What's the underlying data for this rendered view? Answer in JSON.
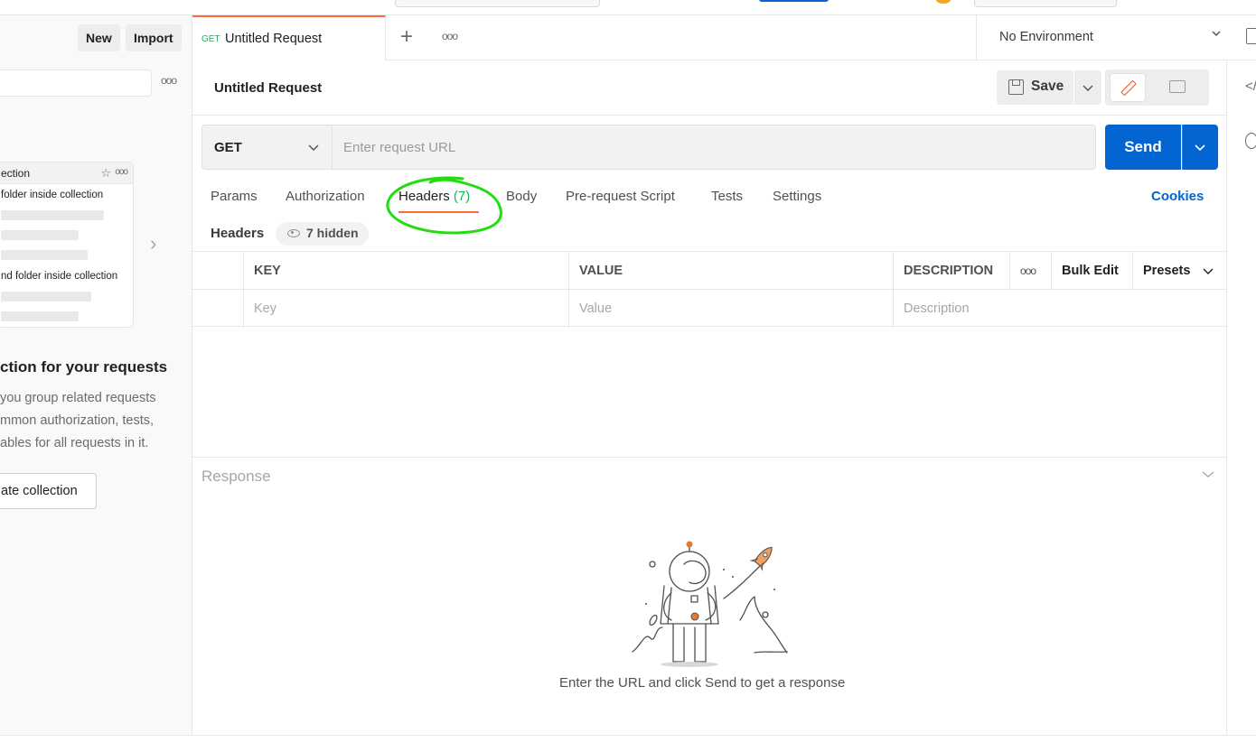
{
  "sidebar": {
    "new_label": "New",
    "import_label": "Import",
    "more_label": "ooo",
    "card": {
      "title": "ection",
      "line1": "folder inside collection",
      "line2": "nd folder inside collection"
    },
    "heading": "ction for your requests",
    "desc1": "you group related requests",
    "desc2": "mmon authorization, tests,",
    "desc3": "ables for all requests in it.",
    "create_label": "ate collection"
  },
  "tabs": {
    "active_method": "GET",
    "active_name": "Untitled Request",
    "more_label": "ooo"
  },
  "environment": {
    "label": "No Environment"
  },
  "request": {
    "title": "Untitled Request",
    "save_label": "Save",
    "method": "GET",
    "url_placeholder": "Enter request URL",
    "url_value": "",
    "send_label": "Send"
  },
  "request_tabs": {
    "params": "Params",
    "authorization": "Authorization",
    "headers": "Headers",
    "headers_count": "(7)",
    "body": "Body",
    "pre_request": "Pre-request Script",
    "tests": "Tests",
    "settings": "Settings",
    "cookies": "Cookies"
  },
  "headers_section": {
    "label": "Headers",
    "hidden_label": "7 hidden",
    "columns": {
      "key": "KEY",
      "value": "VALUE",
      "description": "DESCRIPTION",
      "more": "ooo",
      "bulk_edit": "Bulk Edit",
      "presets": "Presets"
    },
    "placeholders": {
      "key": "Key",
      "value": "Value",
      "description": "Description"
    }
  },
  "response": {
    "label": "Response",
    "hint": "Enter the URL and click Send to get a response"
  },
  "colors": {
    "accent_orange": "#ff6c37",
    "send_blue": "#0265d2",
    "method_green": "#0cbb52",
    "annotation_green": "#22dd11"
  }
}
